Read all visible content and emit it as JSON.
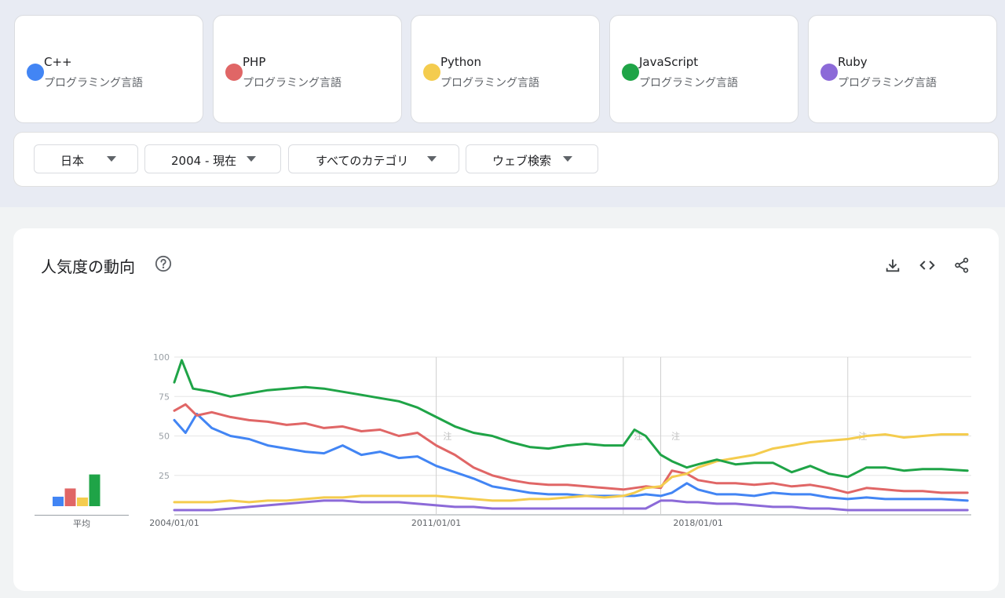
{
  "terms": [
    {
      "name": "C++",
      "category": "プログラミング言語",
      "color": "#4285f4"
    },
    {
      "name": "PHP",
      "category": "プログラミング言語",
      "color": "#e06666"
    },
    {
      "name": "Python",
      "category": "プログラミング言語",
      "color": "#f4cc4e"
    },
    {
      "name": "JavaScript",
      "category": "プログラミング言語",
      "color": "#1fa447"
    },
    {
      "name": "Ruby",
      "category": "プログラミング言語",
      "color": "#8c6ad8"
    }
  ],
  "filters": {
    "region": "日本",
    "time": "2004 - 現在",
    "category": "すべてのカテゴリ",
    "property": "ウェブ検索"
  },
  "panel": {
    "title": "人気度の動向",
    "average_label": "平均",
    "annotation_marker": "注"
  },
  "chart_data": {
    "type": "line",
    "y_ticks": [
      100,
      75,
      50,
      25
    ],
    "ylim": [
      0,
      100
    ],
    "x_range": [
      2004,
      2025.3
    ],
    "x_tick_labels": [
      {
        "x": 2004,
        "label": "2004/01/01"
      },
      {
        "x": 2011,
        "label": "2011/01/01"
      },
      {
        "x": 2018,
        "label": "2018/01/01"
      }
    ],
    "annotation_lines": [
      2011,
      2016,
      2017,
      2022
    ],
    "annotation_markers": [
      2011.1,
      2016.2,
      2017.2,
      2022.2
    ],
    "series": [
      {
        "name": "C++",
        "color": "#4285f4",
        "average": 22,
        "x": [
          2004,
          2004.3,
          2004.6,
          2005,
          2005.5,
          2006,
          2006.5,
          2007,
          2007.5,
          2008,
          2008.5,
          2009,
          2009.5,
          2010,
          2010.5,
          2011,
          2011.5,
          2012,
          2012.5,
          2013,
          2013.5,
          2014,
          2014.5,
          2015,
          2015.5,
          2016,
          2016.3,
          2016.6,
          2017,
          2017.3,
          2017.7,
          2018,
          2018.5,
          2019,
          2019.5,
          2020,
          2020.5,
          2021,
          2021.5,
          2022,
          2022.5,
          2023,
          2023.5,
          2024,
          2024.5,
          2025.2
        ],
        "values": [
          60,
          52,
          64,
          55,
          50,
          48,
          44,
          42,
          40,
          39,
          44,
          38,
          40,
          36,
          37,
          31,
          27,
          23,
          18,
          16,
          14,
          13,
          13,
          12,
          12,
          12,
          12,
          13,
          12,
          14,
          20,
          16,
          13,
          13,
          12,
          14,
          13,
          13,
          11,
          10,
          11,
          10,
          10,
          10,
          10,
          9
        ]
      },
      {
        "name": "PHP",
        "color": "#e06666",
        "average": 32,
        "x": [
          2004,
          2004.3,
          2004.6,
          2005,
          2005.5,
          2006,
          2006.5,
          2007,
          2007.5,
          2008,
          2008.5,
          2009,
          2009.5,
          2010,
          2010.5,
          2011,
          2011.5,
          2012,
          2012.5,
          2013,
          2013.5,
          2014,
          2014.5,
          2015,
          2015.5,
          2016,
          2016.3,
          2016.6,
          2017,
          2017.3,
          2017.7,
          2018,
          2018.5,
          2019,
          2019.5,
          2020,
          2020.5,
          2021,
          2021.5,
          2022,
          2022.5,
          2023,
          2023.5,
          2024,
          2024.5,
          2025.2
        ],
        "values": [
          66,
          70,
          63,
          65,
          62,
          60,
          59,
          57,
          58,
          55,
          56,
          53,
          54,
          50,
          52,
          44,
          38,
          30,
          25,
          22,
          20,
          19,
          19,
          18,
          17,
          16,
          17,
          18,
          17,
          28,
          26,
          22,
          20,
          20,
          19,
          20,
          18,
          19,
          17,
          14,
          17,
          16,
          15,
          15,
          14,
          14
        ]
      },
      {
        "name": "Python",
        "color": "#f4cc4e",
        "average": 21,
        "x": [
          2004,
          2004.6,
          2005,
          2005.5,
          2006,
          2006.5,
          2007,
          2007.5,
          2008,
          2008.5,
          2009,
          2009.5,
          2010,
          2010.5,
          2011,
          2011.5,
          2012,
          2012.5,
          2013,
          2013.5,
          2014,
          2014.5,
          2015,
          2015.5,
          2016,
          2016.3,
          2016.6,
          2017,
          2017.3,
          2017.7,
          2018,
          2018.5,
          2019,
          2019.5,
          2020,
          2020.5,
          2021,
          2021.5,
          2022,
          2022.5,
          2023,
          2023.5,
          2024,
          2024.5,
          2025.2
        ],
        "values": [
          8,
          8,
          8,
          9,
          8,
          9,
          9,
          10,
          11,
          11,
          12,
          12,
          12,
          12,
          12,
          11,
          10,
          9,
          9,
          10,
          10,
          11,
          12,
          11,
          12,
          14,
          17,
          18,
          24,
          26,
          30,
          34,
          36,
          38,
          42,
          44,
          46,
          47,
          48,
          50,
          51,
          49,
          50,
          51,
          51
        ]
      },
      {
        "name": "JavaScript",
        "color": "#1fa447",
        "average": 49,
        "x": [
          2004,
          2004.2,
          2004.5,
          2005,
          2005.5,
          2006,
          2006.5,
          2007,
          2007.5,
          2008,
          2008.5,
          2009,
          2009.5,
          2010,
          2010.5,
          2011,
          2011.5,
          2012,
          2012.5,
          2013,
          2013.5,
          2014,
          2014.5,
          2015,
          2015.5,
          2016,
          2016.3,
          2016.6,
          2017,
          2017.3,
          2017.7,
          2018,
          2018.5,
          2019,
          2019.5,
          2020,
          2020.5,
          2021,
          2021.5,
          2022,
          2022.5,
          2023,
          2023.5,
          2024,
          2024.5,
          2025.2
        ],
        "values": [
          84,
          98,
          80,
          78,
          75,
          77,
          79,
          80,
          81,
          80,
          78,
          76,
          74,
          72,
          68,
          62,
          56,
          52,
          50,
          46,
          43,
          42,
          44,
          45,
          44,
          44,
          54,
          50,
          38,
          34,
          30,
          32,
          35,
          32,
          33,
          33,
          27,
          31,
          26,
          24,
          30,
          30,
          28,
          29,
          29,
          28
        ]
      },
      {
        "name": "Ruby",
        "color": "#8c6ad8",
        "average": 4,
        "x": [
          2004,
          2004.5,
          2005,
          2005.5,
          2006,
          2006.5,
          2007,
          2007.5,
          2008,
          2008.5,
          2009,
          2009.5,
          2010,
          2010.5,
          2011,
          2011.5,
          2012,
          2012.5,
          2013,
          2013.5,
          2014,
          2014.5,
          2015,
          2015.5,
          2016,
          2016.3,
          2016.6,
          2017,
          2017.3,
          2017.7,
          2018,
          2018.5,
          2019,
          2019.5,
          2020,
          2020.5,
          2021,
          2021.5,
          2022,
          2022.5,
          2023,
          2023.5,
          2024,
          2024.5,
          2025.2
        ],
        "values": [
          3,
          3,
          3,
          4,
          5,
          6,
          7,
          8,
          9,
          9,
          8,
          8,
          8,
          7,
          6,
          5,
          5,
          4,
          4,
          4,
          4,
          4,
          4,
          4,
          4,
          4,
          4,
          9,
          9,
          8,
          8,
          7,
          7,
          6,
          5,
          5,
          4,
          4,
          3,
          3,
          3,
          3,
          3,
          3,
          3
        ]
      }
    ]
  }
}
